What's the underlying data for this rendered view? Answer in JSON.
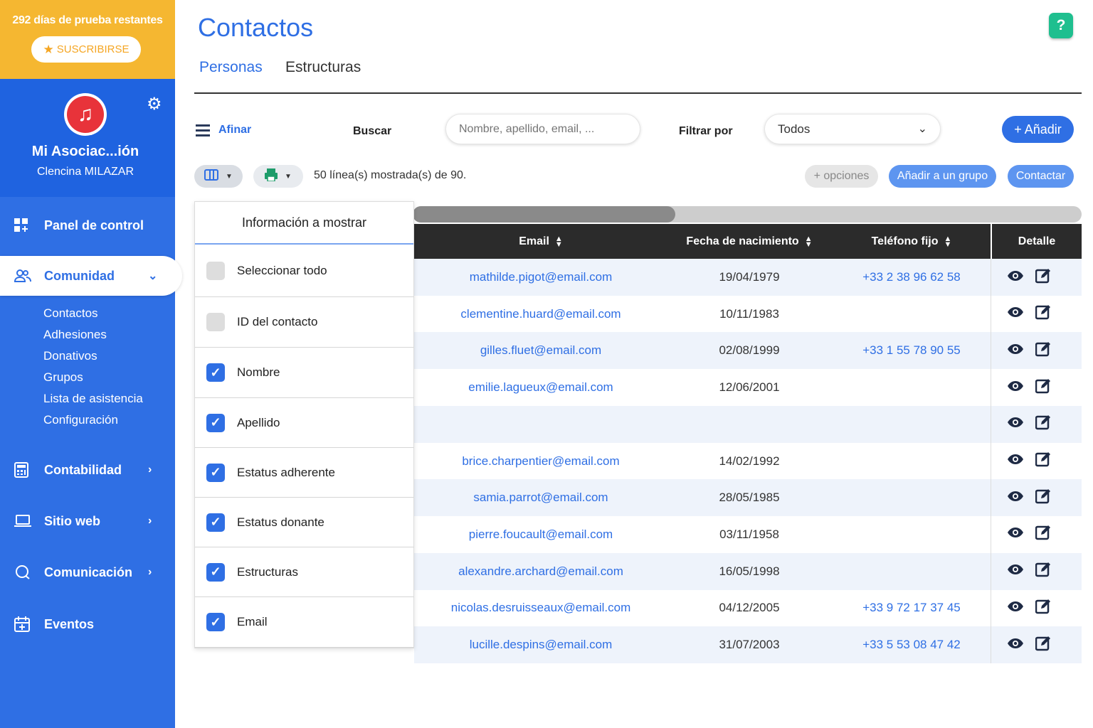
{
  "trial": {
    "text": "292 días de prueba restantes",
    "subscribe_label": "SUSCRIBIRSE"
  },
  "org": {
    "name": "Mi Asociac...ión",
    "user": "Clencina MILAZAR"
  },
  "nav": {
    "panel": "Panel de control",
    "comunidad": "Comunidad",
    "sub": [
      "Contactos",
      "Adhesiones",
      "Donativos",
      "Grupos",
      "Lista de asistencia",
      "Configuración"
    ],
    "contabilidad": "Contabilidad",
    "sitio": "Sitio web",
    "comunicacion": "Comunicación",
    "eventos": "Eventos"
  },
  "page": {
    "title": "Contactos",
    "help": "?"
  },
  "tabs": [
    "Personas",
    "Estructuras"
  ],
  "toolbar": {
    "refine": "Afinar",
    "search_label": "Buscar",
    "search_placeholder": "Nombre, apellido, email, ...",
    "filter_label": "Filtrar por",
    "filter_value": "Todos",
    "add": "+ Añadir",
    "count": "50 línea(s) mostrada(s) de 90.",
    "options": "+ opciones",
    "add_group": "Añadir a un grupo",
    "contact": "Contactar"
  },
  "table": {
    "headers": {
      "email": "Email",
      "birth": "Fecha de nacimiento",
      "phone": "Teléfono fijo",
      "detail": "Detalle"
    },
    "rows": [
      {
        "email": "mathilde.pigot@email.com",
        "birth": "19/04/1979",
        "phone": "+33 2 38 96 62 58"
      },
      {
        "email": "clementine.huard@email.com",
        "birth": "10/11/1983",
        "phone": ""
      },
      {
        "email": "gilles.fluet@email.com",
        "birth": "02/08/1999",
        "phone": "+33 1 55 78 90 55"
      },
      {
        "email": "emilie.lagueux@email.com",
        "birth": "12/06/2001",
        "phone": ""
      },
      {
        "email": "",
        "birth": "",
        "phone": ""
      },
      {
        "email": "brice.charpentier@email.com",
        "birth": "14/02/1992",
        "phone": ""
      },
      {
        "email": "samia.parrot@email.com",
        "birth": "28/05/1985",
        "phone": ""
      },
      {
        "email": "pierre.foucault@email.com",
        "birth": "03/11/1958",
        "phone": ""
      },
      {
        "email": "alexandre.archard@email.com",
        "birth": "16/05/1998",
        "phone": ""
      },
      {
        "email": "nicolas.desruisseaux@email.com",
        "birth": "04/12/2005",
        "phone": "+33 9 72 17 37 45"
      },
      {
        "email": "lucille.despins@email.com",
        "birth": "31/07/2003",
        "phone": "+33 5 53 08 47 42"
      }
    ]
  },
  "columns_panel": {
    "title": "Información a mostrar",
    "options": [
      {
        "label": "Seleccionar todo",
        "checked": false
      },
      {
        "label": "ID del contacto",
        "checked": false
      },
      {
        "label": "Nombre",
        "checked": true
      },
      {
        "label": "Apellido",
        "checked": true
      },
      {
        "label": "Estatus adherente",
        "checked": true
      },
      {
        "label": "Estatus donante",
        "checked": true
      },
      {
        "label": "Estructuras",
        "checked": true
      },
      {
        "label": "Email",
        "checked": true
      }
    ]
  },
  "colors": {
    "primary": "#2f6fe4",
    "sidebar": "#2f6fe4",
    "trial": "#f5b731",
    "help": "#1fbf8f"
  }
}
